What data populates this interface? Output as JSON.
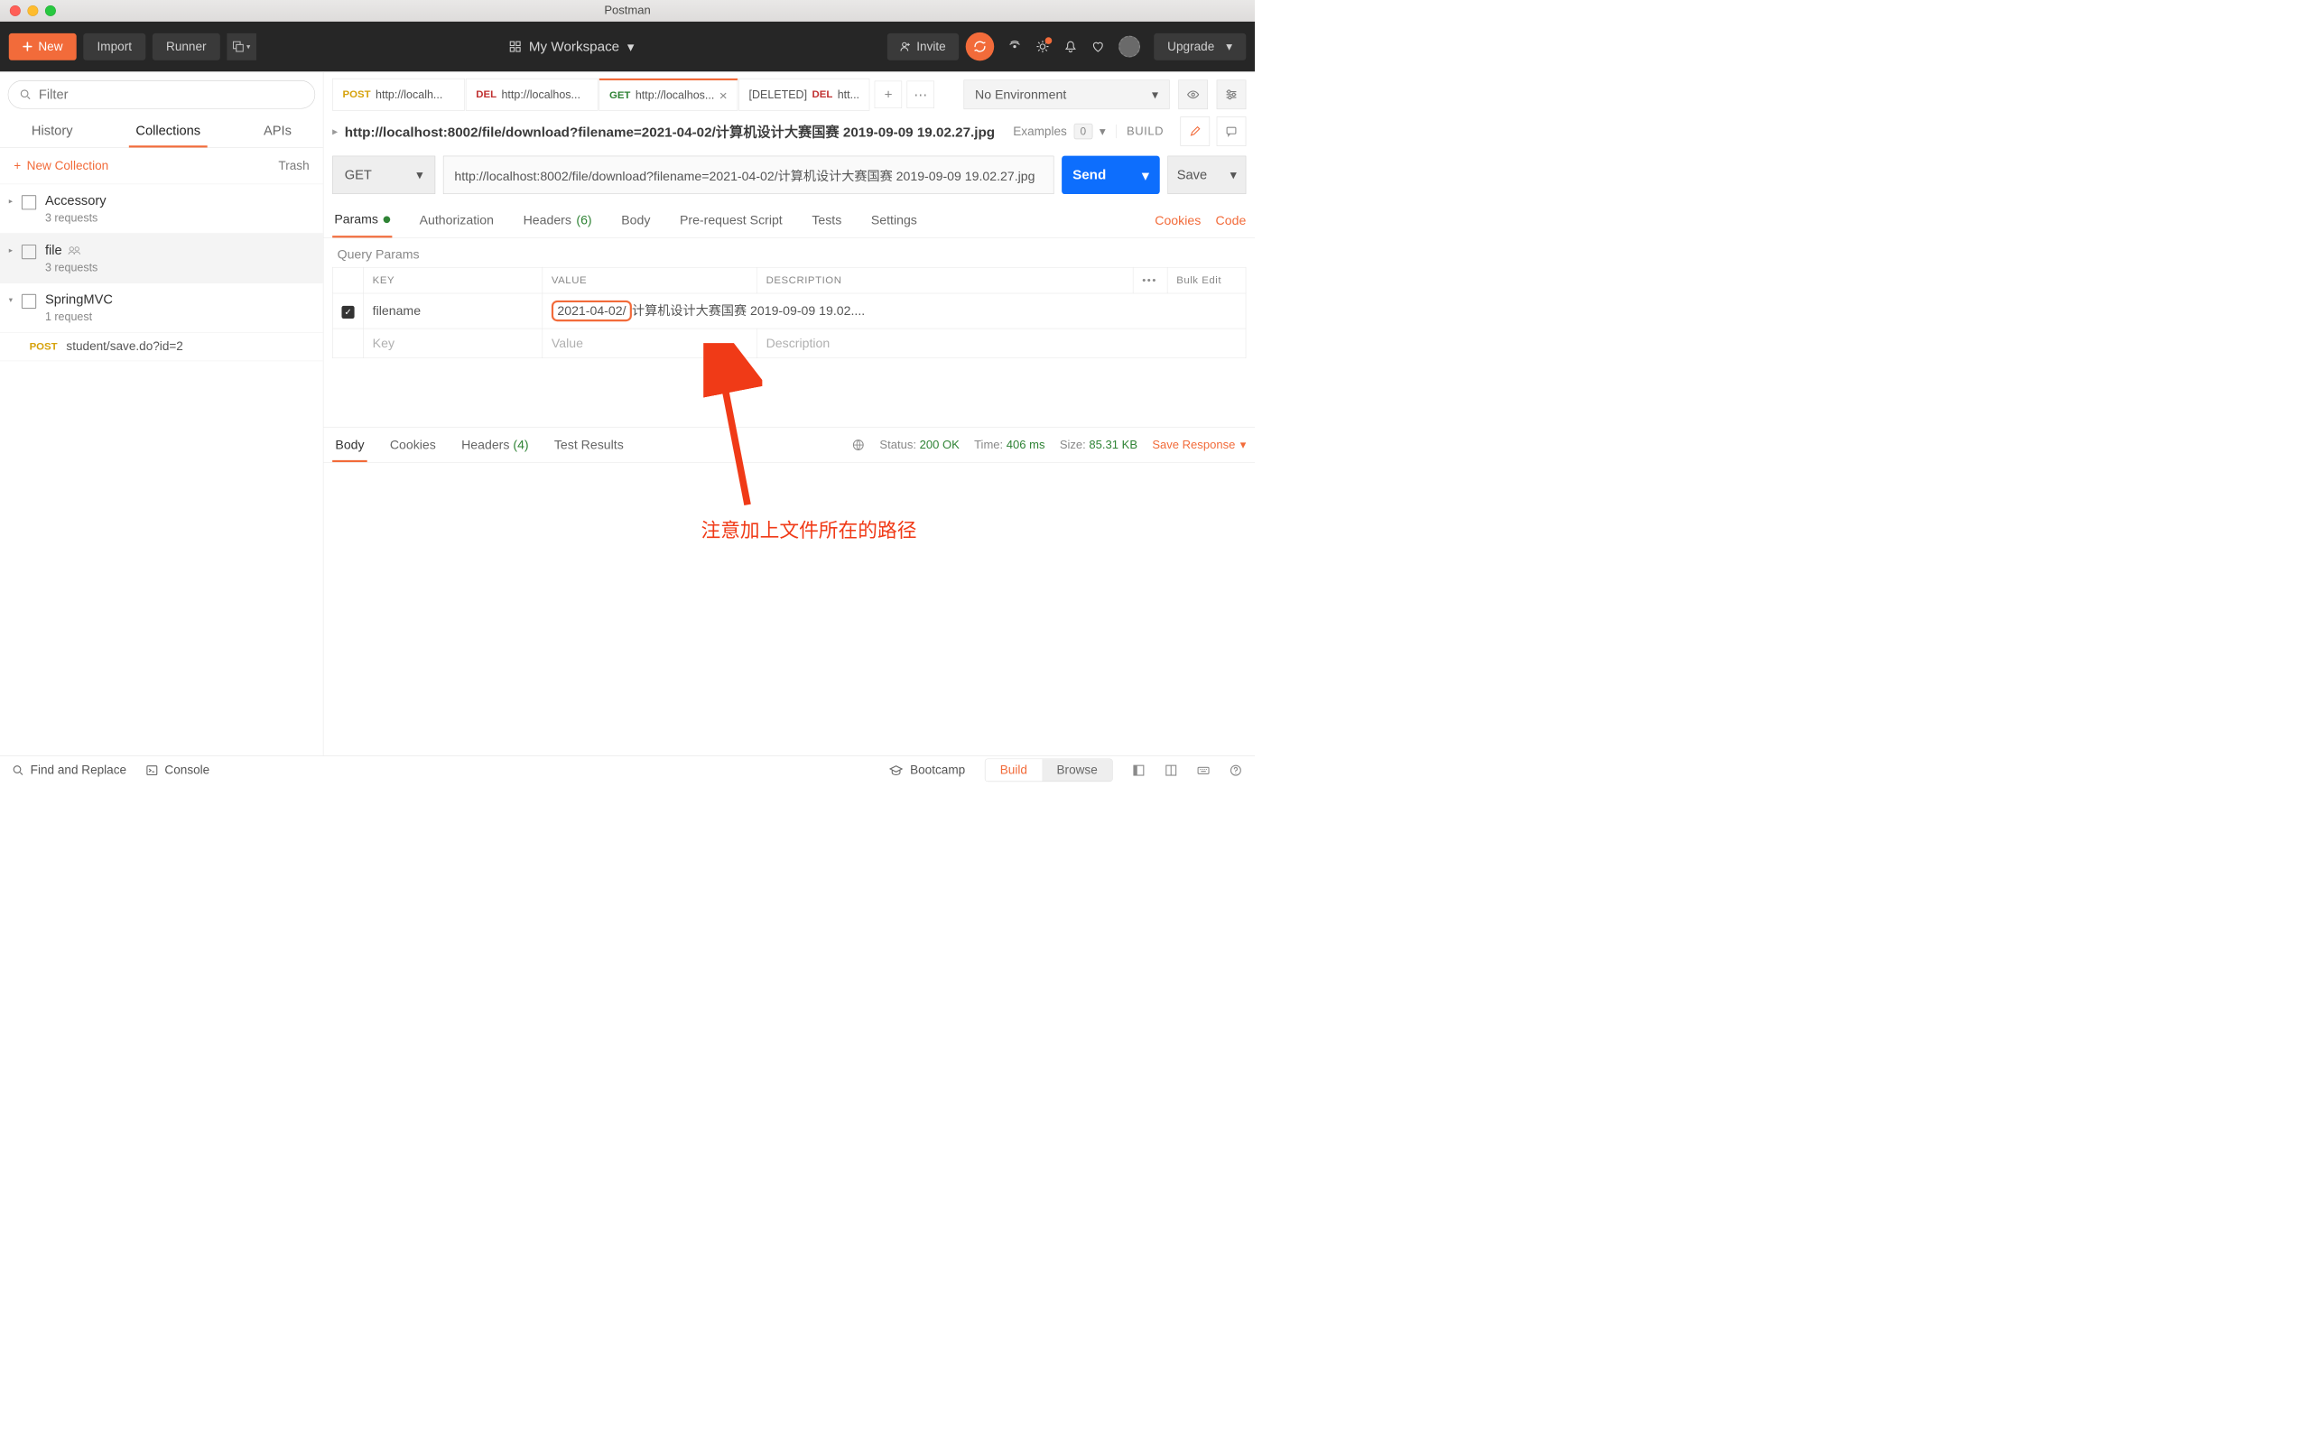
{
  "window": {
    "title": "Postman"
  },
  "toolbar": {
    "new": "New",
    "import": "Import",
    "runner": "Runner",
    "workspace": "My Workspace",
    "invite": "Invite",
    "upgrade": "Upgrade"
  },
  "sidebar": {
    "filter_placeholder": "Filter",
    "tabs": {
      "history": "History",
      "collections": "Collections",
      "apis": "APIs"
    },
    "new_collection": "New Collection",
    "trash": "Trash",
    "collections": [
      {
        "name": "Accessory",
        "meta": "3 requests"
      },
      {
        "name": "file",
        "meta": "3 requests"
      },
      {
        "name": "SpringMVC",
        "meta": "1 request"
      }
    ],
    "sub_item": {
      "method": "POST",
      "path": "student/save.do?id=2"
    }
  },
  "tabs": [
    {
      "method": "POST",
      "label": "http://localh..."
    },
    {
      "method": "DEL",
      "label": "http://localhos..."
    },
    {
      "method": "GET",
      "label": "http://localhos...",
      "active": true
    },
    {
      "method": "DEL",
      "label": "htt...",
      "prefix": "[DELETED]"
    }
  ],
  "environment": {
    "selected": "No Environment"
  },
  "request": {
    "url_display": "http://localhost:8002/file/download?filename=2021-04-02/计算机设计大赛国赛 2019-09-09 19.02.27.jpg",
    "examples_label": "Examples",
    "examples_count": "0",
    "build": "BUILD",
    "method": "GET",
    "url": "http://localhost:8002/file/download?filename=2021-04-02/计算机设计大赛国赛 2019-09-09 19.02.27.jpg",
    "send": "Send",
    "save": "Save",
    "subtabs": {
      "params": "Params",
      "auth": "Authorization",
      "headers": "Headers",
      "headers_count": "(6)",
      "body": "Body",
      "pre": "Pre-request Script",
      "tests": "Tests",
      "settings": "Settings",
      "cookies": "Cookies",
      "code": "Code"
    },
    "query_params_title": "Query Params",
    "columns": {
      "key": "KEY",
      "value": "VALUE",
      "desc": "DESCRIPTION",
      "bulk": "Bulk Edit"
    },
    "params": [
      {
        "key": "filename",
        "value_hl": "2021-04-02/",
        "value_rest": "计算机设计大赛国赛 2019-09-09 19.02...."
      }
    ],
    "placeholder": {
      "key": "Key",
      "value": "Value",
      "desc": "Description"
    }
  },
  "response": {
    "tabs": {
      "body": "Body",
      "cookies": "Cookies",
      "headers": "Headers",
      "headers_count": "(4)",
      "tests": "Test Results"
    },
    "status_label": "Status:",
    "status_value": "200 OK",
    "time_label": "Time:",
    "time_value": "406 ms",
    "size_label": "Size:",
    "size_value": "85.31 KB",
    "save": "Save Response"
  },
  "annotation": {
    "text": "注意加上文件所在的路径"
  },
  "statusbar": {
    "find": "Find and Replace",
    "console": "Console",
    "bootcamp": "Bootcamp",
    "build": "Build",
    "browse": "Browse"
  }
}
